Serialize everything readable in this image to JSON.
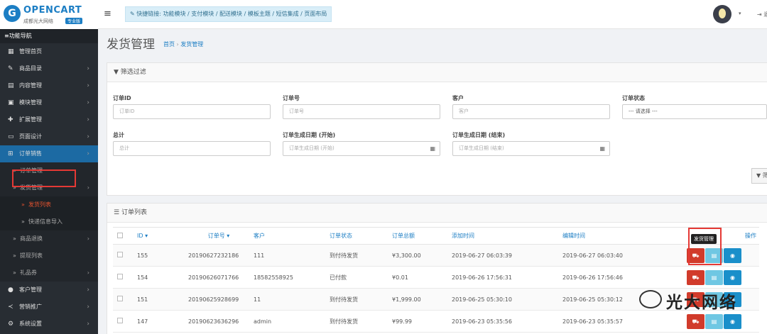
{
  "header": {
    "logo_mark": "G",
    "logo_text": "OPENCART",
    "logo_sub": "成都光大网络",
    "logo_badge": "专业版",
    "menu_icon": "menu-icon",
    "quick_links_label": "✎ 快捷链接:",
    "quick_links": [
      "功能模块",
      "支付模块",
      "配送模块",
      "模板主题",
      "短信集成",
      "页面布局"
    ],
    "avatar_caret": "▾",
    "logout_label": "⇥ 退"
  },
  "sidebar": {
    "title": "≡功能导航",
    "items": [
      {
        "icon": "▦",
        "label": "管理首页",
        "arrow": ""
      },
      {
        "icon": "✎",
        "label": "商品目录",
        "arrow": "›"
      },
      {
        "icon": "▤",
        "label": "内容管理",
        "arrow": "›"
      },
      {
        "icon": "▣",
        "label": "模块管理",
        "arrow": "›"
      },
      {
        "icon": "✚",
        "label": "扩展管理",
        "arrow": "›"
      },
      {
        "icon": "▭",
        "label": "页面设计",
        "arrow": "›"
      },
      {
        "icon": "⊞",
        "label": "订单销售",
        "arrow": "›"
      }
    ],
    "sub_items": [
      {
        "label": "订单管理",
        "arrow": ""
      },
      {
        "label": "发货管理",
        "arrow": "›"
      }
    ],
    "sub2_items": [
      {
        "label": "发货列表"
      },
      {
        "label": "快递信息导入"
      }
    ],
    "sub_items_after": [
      {
        "label": "商品退换",
        "arrow": "›"
      },
      {
        "label": "提现列表",
        "arrow": ""
      },
      {
        "label": "礼品券",
        "arrow": "›"
      }
    ],
    "items_after": [
      {
        "icon": "●",
        "label": "客户管理",
        "arrow": "›"
      },
      {
        "icon": "≺",
        "label": "营销推广",
        "arrow": "›"
      },
      {
        "icon": "⚙",
        "label": "系统设置",
        "arrow": "›"
      }
    ]
  },
  "page": {
    "title": "发货管理",
    "breadcrumb": [
      "首页",
      "发货管理"
    ]
  },
  "filter": {
    "title": "筛选过滤",
    "fields": {
      "order_id": {
        "label": "订单ID",
        "placeholder": "订单ID"
      },
      "order_no": {
        "label": "订单号",
        "placeholder": "订单号"
      },
      "customer": {
        "label": "客户",
        "placeholder": "客户"
      },
      "status": {
        "label": "订单状态",
        "value": "--- 请选择 ---"
      },
      "total": {
        "label": "总计",
        "placeholder": "总计"
      },
      "date_start": {
        "label": "订单生成日期 (开始)",
        "placeholder": "订单生成日期 (开始)"
      },
      "date_end": {
        "label": "订单生成日期 (结束)",
        "placeholder": "订单生成日期 (结束)"
      }
    },
    "filter_button": "▼ 筛"
  },
  "orders": {
    "title": "订单列表",
    "columns": [
      "ID ▾",
      "订单号 ▾",
      "客户",
      "订单状态",
      "订单总额",
      "添加时间",
      "编辑时间",
      "操作"
    ],
    "rows": [
      {
        "id": "155",
        "order_no": "20190627232186",
        "customer": "111",
        "status": "到付待发货",
        "total": "¥3,300.00",
        "added": "2019-06-27 06:03:39",
        "modified": "2019-06-27 06:03:40"
      },
      {
        "id": "154",
        "order_no": "20190626071766",
        "customer": "18582558925",
        "status": "已付款",
        "total": "¥0.01",
        "added": "2019-06-26 17:56:31",
        "modified": "2019-06-26 17:56:46"
      },
      {
        "id": "151",
        "order_no": "20190625928699",
        "customer": "11",
        "status": "到付待发货",
        "total": "¥1,999.00",
        "added": "2019-06-25 05:30:10",
        "modified": "2019-06-25 05:30:12"
      },
      {
        "id": "147",
        "order_no": "20190623636296",
        "customer": "admin",
        "status": "到付待发货",
        "total": "¥99.99",
        "added": "2019-06-23 05:35:56",
        "modified": "2019-06-23 05:35:57"
      }
    ],
    "tooltip": "发货管理",
    "action_icons": {
      "ship": "truck-icon",
      "print": "print-icon",
      "view": "eye-icon"
    }
  },
  "watermark": {
    "text": "光大网络"
  },
  "colors": {
    "accent": "#1c7ec4",
    "sidebar": "#282d33",
    "danger": "#d13b2b",
    "info": "#1a8fca"
  }
}
